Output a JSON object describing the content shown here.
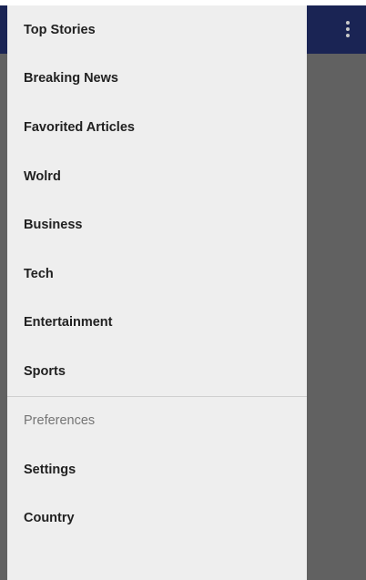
{
  "drawer": {
    "items": [
      {
        "label": "Top Stories"
      },
      {
        "label": "Breaking News"
      },
      {
        "label": "Favorited Articles"
      },
      {
        "label": "Wolrd"
      },
      {
        "label": "Business"
      },
      {
        "label": "Tech"
      },
      {
        "label": "Entertainment"
      },
      {
        "label": "Sports"
      }
    ],
    "preferences": {
      "header": "Preferences",
      "items": [
        {
          "label": "Settings"
        },
        {
          "label": "Country"
        }
      ]
    }
  },
  "toolbar": {
    "overflow_icon": "more-vert-icon"
  },
  "colors": {
    "toolbar": "#1a2454",
    "scrim": "#616161",
    "drawer_bg": "#eeeeee",
    "section_header": "#757575"
  }
}
